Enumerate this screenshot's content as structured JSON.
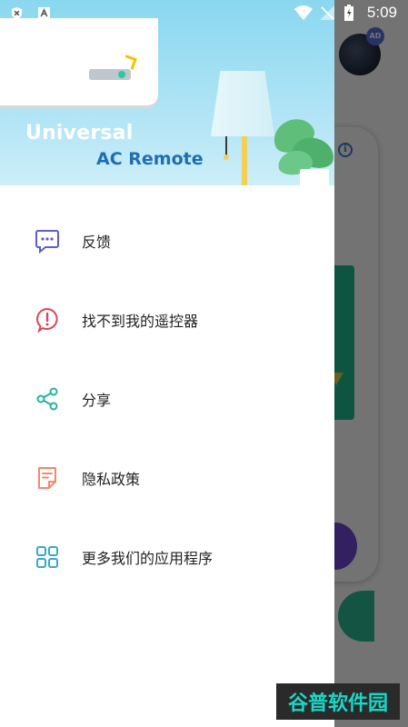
{
  "status_bar": {
    "time": "5:09",
    "icons": [
      "shield-icon",
      "a-box-icon",
      "wifi-icon",
      "no-signal-icon",
      "battery-charging-icon"
    ]
  },
  "background": {
    "avatar_badge": "AD"
  },
  "drawer": {
    "hero": {
      "title_line1": "Universal",
      "title_line2": "AC Remote"
    },
    "menu": [
      {
        "label": "反馈",
        "icon": "feedback-icon",
        "color": "#5b5fc7"
      },
      {
        "label": "找不到我的遥控器",
        "icon": "alert-bubble-icon",
        "color": "#d9475a"
      },
      {
        "label": "分享",
        "icon": "share-icon",
        "color": "#26b29a"
      },
      {
        "label": "隐私政策",
        "icon": "policy-document-icon",
        "color": "#f08a6a"
      },
      {
        "label": "更多我们的应用程序",
        "icon": "grid-apps-icon",
        "color": "#39a7c9"
      }
    ]
  },
  "watermark": {
    "text": "谷普软件园"
  }
}
